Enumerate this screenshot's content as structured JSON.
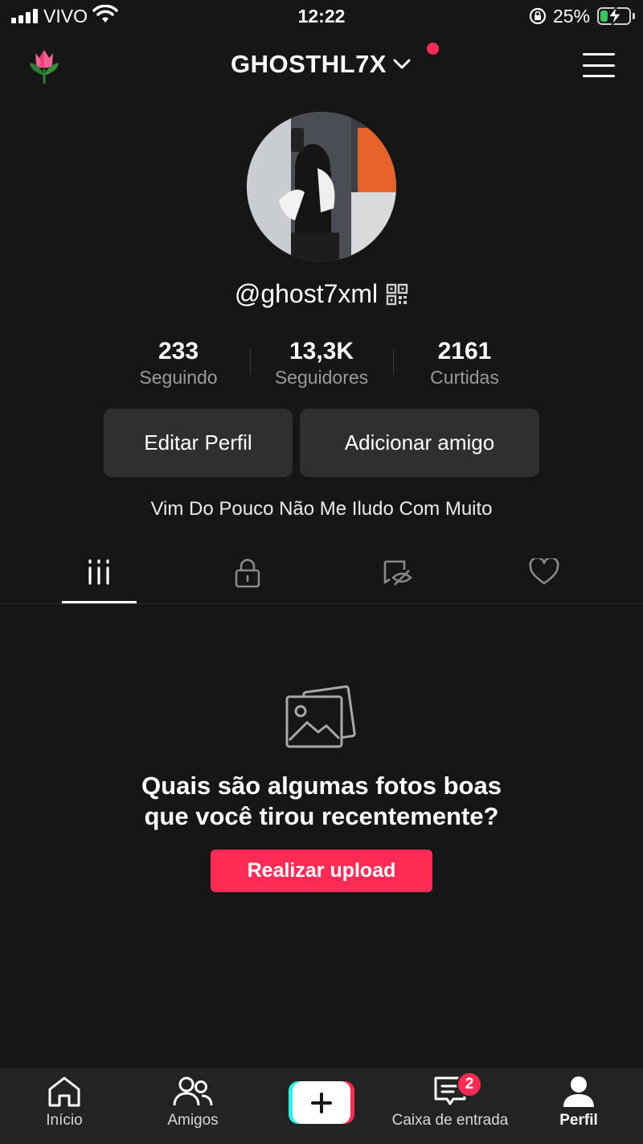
{
  "status_bar": {
    "carrier": "VIVO",
    "time": "12:22",
    "battery_percent": "25%",
    "battery_level": 0.25,
    "icons": [
      "signal-icon",
      "wifi-icon",
      "orientation-lock-icon",
      "battery-charging-icon"
    ]
  },
  "header": {
    "username": "GHOSTHL7X",
    "icons": [
      "flower-icon",
      "chevron-down-icon",
      "menu-icon"
    ],
    "notification_dot_color": "#fe2c55"
  },
  "profile": {
    "handle": "@ghost7xml",
    "stats": [
      {
        "value": "233",
        "label": "Seguindo"
      },
      {
        "value": "13,3K",
        "label": "Seguidores"
      },
      {
        "value": "2161",
        "label": "Curtidas"
      }
    ],
    "edit_button": "Editar Perfil",
    "add_friend_button": "Adicionar amigo",
    "bio": "Vim Do Pouco Não Me Iludo Com Muito"
  },
  "tabs": [
    {
      "icon": "grid-icon",
      "active": true
    },
    {
      "icon": "lock-icon",
      "active": false
    },
    {
      "icon": "hidden-likes-icon",
      "active": false
    },
    {
      "icon": "heart-icon",
      "active": false
    }
  ],
  "empty_state": {
    "icon": "photos-icon",
    "title_line1": "Quais são algumas fotos boas",
    "title_line2": "que você tirou recentemente?",
    "button": "Realizar upload"
  },
  "bottom_nav": {
    "items": [
      {
        "label": "Início",
        "icon": "home-icon"
      },
      {
        "label": "Amigos",
        "icon": "friends-icon"
      },
      {
        "label": "",
        "icon": "plus-icon"
      },
      {
        "label": "Caixa de entrada",
        "icon": "inbox-icon"
      },
      {
        "label": "Perfil",
        "icon": "profile-icon"
      }
    ],
    "inbox_badge": "2"
  },
  "colors": {
    "background": "#161616",
    "accent": "#fe2c55",
    "cyan": "#25f4ee",
    "button_gray": "#2f2f2f"
  }
}
